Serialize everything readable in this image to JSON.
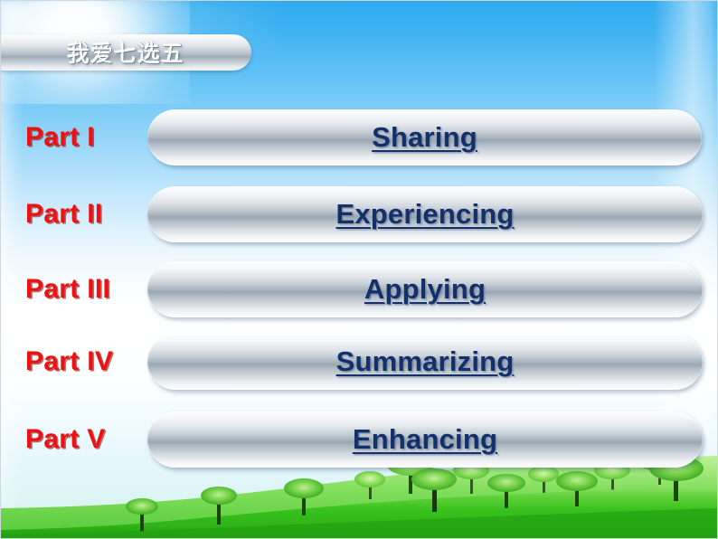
{
  "slide": {
    "title_tab": "我爱七选五",
    "colors": {
      "part_label": "#ee1111",
      "pill_text": "#14306a",
      "sky_top": "#2eaaf0",
      "sky_mid": "#ffffff",
      "sky_bottom": "#d6f1fa",
      "grass": "#3fbf23"
    },
    "rows": [
      {
        "part": "Part I",
        "label": "Sharing"
      },
      {
        "part": "Part II",
        "label": "Experiencing"
      },
      {
        "part": "Part III",
        "label": "Applying"
      },
      {
        "part": "Part IV",
        "label": "Summarizing"
      },
      {
        "part": "Part V",
        "label": "Enhancing"
      }
    ],
    "background": {
      "scene": "blue-sky-with-sun-glow-and-green-hill-with-trees",
      "sun_glow": "top-left-sun-glow",
      "landscape": "green-grass-hill-with-trees"
    }
  }
}
